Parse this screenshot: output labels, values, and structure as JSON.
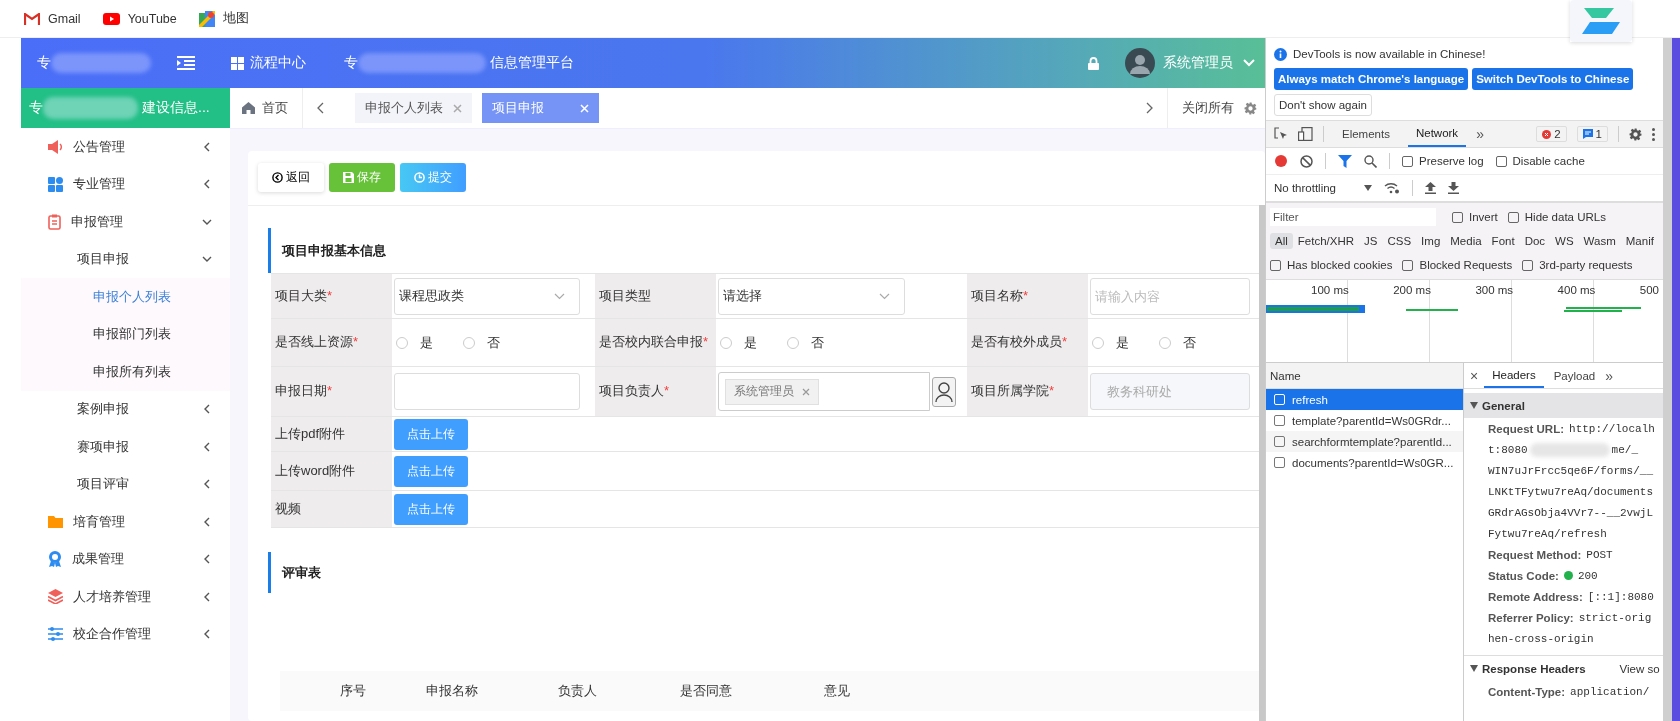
{
  "bookmarks": [
    {
      "label": "Gmail"
    },
    {
      "label": "YouTube"
    },
    {
      "label": "地图"
    }
  ],
  "header": {
    "title_lead": "专",
    "nav_label": "流程中心",
    "platform_lead": "专",
    "platform_title": "信息管理平台",
    "user": "系统管理员"
  },
  "sidebar": {
    "title_lead": "专",
    "title": "建设信息...",
    "items": [
      {
        "label": "公告管理",
        "expanded": false
      },
      {
        "label": "专业管理",
        "expanded": false
      },
      {
        "label": "申报管理",
        "expanded": true,
        "children": [
          {
            "label": "项目申报",
            "expanded": true,
            "children": [
              {
                "label": "申报个人列表",
                "selected": true
              },
              {
                "label": "申报部门列表",
                "selected": false
              },
              {
                "label": "申报所有列表",
                "selected": false
              }
            ]
          },
          {
            "label": "案例申报",
            "expanded": false
          },
          {
            "label": "赛项申报",
            "expanded": false
          },
          {
            "label": "项目评审",
            "expanded": false
          }
        ]
      },
      {
        "label": "培育管理",
        "expanded": false
      },
      {
        "label": "成果管理",
        "expanded": false
      },
      {
        "label": "人才培养管理",
        "expanded": false
      },
      {
        "label": "校企合作管理",
        "expanded": false
      }
    ]
  },
  "tabs": {
    "home": "首页",
    "items": [
      {
        "label": "申报个人列表",
        "selected": false
      },
      {
        "label": "项目申报",
        "selected": true
      }
    ],
    "close_all": "关闭所有"
  },
  "toolbar": [
    {
      "label": "返回",
      "kind": "back"
    },
    {
      "label": "保存",
      "kind": "save"
    },
    {
      "label": "提交",
      "kind": "submit"
    }
  ],
  "form": {
    "title": "项目申报基本信息",
    "rows": [
      [
        {
          "label": "项目大类",
          "mark": "*",
          "kind": "select",
          "value": "课程思政类"
        },
        {
          "label": "项目类型",
          "kind": "select",
          "placeholder": "请选择"
        },
        {
          "label": "项目名称",
          "mark": "*",
          "kind": "input",
          "placeholder": "请输入内容"
        }
      ],
      [
        {
          "label": "是否线上资源",
          "mark": "*",
          "kind": "radio",
          "options": [
            {
              "label": "是",
              "selected": false
            },
            {
              "label": "否",
              "selected": false
            }
          ]
        },
        {
          "label": "是否校内联合申报",
          "mark": "*",
          "kind": "radio",
          "options": [
            {
              "label": "是",
              "selected": false
            },
            {
              "label": "否",
              "selected": false
            }
          ]
        },
        {
          "label": "是否有校外成员",
          "mark": "*",
          "kind": "radio",
          "options": [
            {
              "label": "是",
              "selected": false
            },
            {
              "label": "否",
              "selected": false
            }
          ]
        }
      ],
      [
        {
          "label": "申报日期",
          "mark": "*",
          "kind": "input"
        },
        {
          "label": "项目负责人",
          "mark": "*",
          "kind": "tags",
          "tags": [
            "系统管理员"
          ]
        },
        {
          "label": "项目所属学院",
          "mark": "*",
          "kind": "input",
          "disabled": true,
          "value": "教务科研处"
        }
      ],
      [
        {
          "label": "上传pdf附件",
          "kind": "upload",
          "button": "点击上传"
        }
      ],
      [
        {
          "label": "上传word附件",
          "kind": "upload",
          "button": "点击上传"
        }
      ],
      [
        {
          "label": "视频",
          "kind": "upload",
          "button": "点击上传"
        }
      ]
    ]
  },
  "review": {
    "title": "评审表",
    "columns": [
      "序号",
      "申报名称",
      "负责人",
      "是否同意",
      "意见"
    ]
  },
  "devtools": {
    "notice": "DevTools is now available in Chinese!",
    "notice_buttons": [
      {
        "label": "Always match Chrome's language",
        "kind": "primary"
      },
      {
        "label": "Switch DevTools to Chinese",
        "kind": "primary"
      },
      {
        "label": "Don't show again",
        "kind": "secondary"
      }
    ],
    "tabs": [
      {
        "label": "Elements",
        "selected": false
      },
      {
        "label": "Network",
        "selected": true
      }
    ],
    "more": "»",
    "errors": "2",
    "messages": "1",
    "options": [
      {
        "label": "Preserve log",
        "checked": false
      },
      {
        "label": "Disable cache",
        "checked": false
      }
    ],
    "throttling": "No throttling",
    "filter": {
      "placeholder": "Filter"
    },
    "filter_options": [
      {
        "label": "Invert",
        "checked": false
      },
      {
        "label": "Hide data URLs",
        "checked": false
      }
    ],
    "types": [
      {
        "label": "All",
        "selected": true
      },
      {
        "label": "Fetch/XHR",
        "selected": false
      },
      {
        "label": "JS",
        "selected": false
      },
      {
        "label": "CSS",
        "selected": false
      },
      {
        "label": "Img",
        "selected": false
      },
      {
        "label": "Media",
        "selected": false
      },
      {
        "label": "Font",
        "selected": false
      },
      {
        "label": "Doc",
        "selected": false
      },
      {
        "label": "WS",
        "selected": false
      },
      {
        "label": "Wasm",
        "selected": false
      },
      {
        "label": "Manif",
        "selected": false
      }
    ],
    "blocked": [
      {
        "label": "Has blocked cookies",
        "checked": false
      },
      {
        "label": "Blocked Requests",
        "checked": false
      },
      {
        "label": "3rd-party requests",
        "checked": false
      }
    ],
    "ticks": [
      "100 ms",
      "200 ms",
      "300 ms",
      "400 ms",
      "500"
    ],
    "requests": {
      "header": "Name",
      "rows": [
        {
          "name": "refresh",
          "selected": true
        },
        {
          "name": "template?parentId=Ws0GRdr...",
          "selected": false
        },
        {
          "name": "searchformtemplate?parentId...",
          "selected": false
        },
        {
          "name": "documents?parentId=Ws0GR...",
          "selected": false
        }
      ]
    },
    "detail": {
      "close": "×",
      "tabs": [
        {
          "label": "Headers",
          "selected": true
        },
        {
          "label": "Payload",
          "selected": false
        }
      ],
      "more": "»",
      "general": {
        "title": "General",
        "expanded": true,
        "fields": [
          {
            "label": "Request URL:",
            "lines": [
              [
                "http://localh"
              ],
              [
                "t:8080",
                "me/_"
              ],
              [
                "WIN7uJrFrcc5qe6F/forms/__"
              ],
              [
                "LNKtTFytwu7reAq/documents"
              ],
              [
                "GRdrAGsObja4VVr7--__2vwjL"
              ],
              [
                "Fytwu7reAq/refresh"
              ]
            ]
          },
          {
            "label": "Request Method:",
            "lines": [
              [
                "POST"
              ]
            ]
          },
          {
            "label": "Status Code:",
            "color": "#22b14c",
            "lines": [
              [
                "200"
              ]
            ]
          },
          {
            "label": "Remote Address:",
            "lines": [
              [
                "[::1]:8080"
              ]
            ]
          },
          {
            "label": "Referrer Policy:",
            "lines": [
              [
                "strict-orig"
              ],
              [
                "hen-cross-origin"
              ]
            ]
          }
        ]
      },
      "response": {
        "title": "Response Headers",
        "expanded": true,
        "link": "View so",
        "fields": [
          {
            "label": "Content-Type:",
            "lines": [
              [
                "application/"
              ]
            ]
          }
        ]
      }
    }
  }
}
